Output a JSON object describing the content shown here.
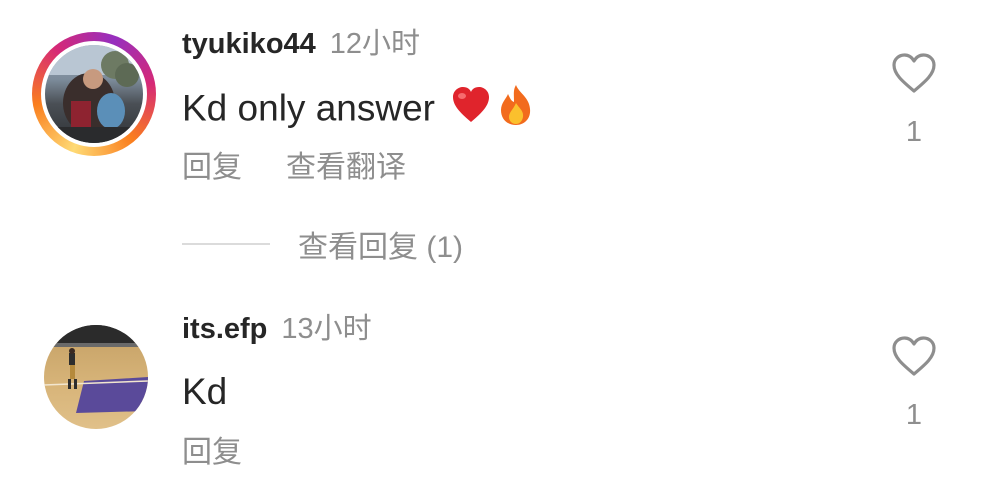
{
  "comments": [
    {
      "username": "tyukiko44",
      "time": "12小时",
      "text": "Kd only answer",
      "emojis": [
        "red-heart",
        "fire"
      ],
      "actions": {
        "reply": "回复",
        "translate": "查看翻译"
      },
      "likes": "1",
      "view_replies": "查看回复 (1)",
      "avatar": "profile-photo"
    },
    {
      "username": "its.efp",
      "time": "13小时",
      "text": "Kd",
      "actions": {
        "reply": "回复"
      },
      "likes": "1",
      "avatar": "basketball-court-photo"
    }
  ],
  "colors": {
    "primary_text": "#262626",
    "secondary_text": "#8e8e8e",
    "divider": "#dbdbdb",
    "story_ring": [
      "#feda75",
      "#fa7e1e",
      "#d62976",
      "#962fbf"
    ]
  }
}
